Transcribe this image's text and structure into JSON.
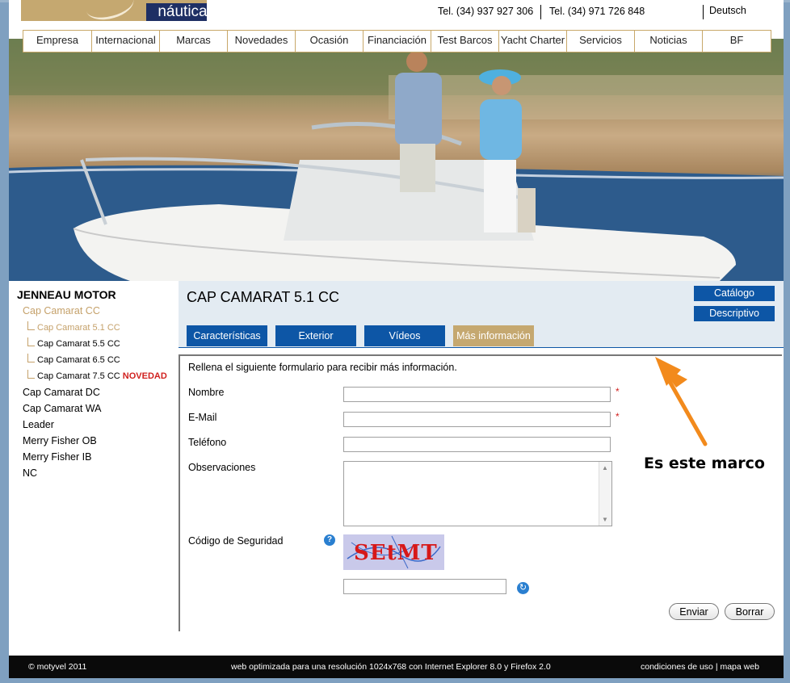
{
  "header": {
    "logo_text": "náutica",
    "phone1": "Tel. (34) 937 927 306",
    "phone2": "Tel. (34) 971 726 848",
    "language": "Deutsch"
  },
  "nav": {
    "items": [
      "Empresa",
      "Internacional",
      "Marcas",
      "Novedades",
      "Ocasión",
      "Financiación",
      "Test Barcos",
      "Yacht Charter",
      "Servicios",
      "Noticias",
      "BF"
    ]
  },
  "sidebar": {
    "title": "JENNEAU MOTOR",
    "group": "Cap Camarat CC",
    "subitems": [
      "Cap Camarat 5.1 CC",
      "Cap Camarat 5.5 CC",
      "Cap Camarat 6.5 CC",
      "Cap Camarat 7.5 CC"
    ],
    "new_badge": "NOVEDAD",
    "items": [
      "Cap Camarat DC",
      "Cap Camarat WA",
      "Leader",
      "Merry Fisher OB",
      "Merry Fisher IB",
      "NC"
    ]
  },
  "content": {
    "title": "CAP CAMARAT 5.1 CC",
    "buttons": [
      "Catálogo",
      "Descriptivo"
    ],
    "tabs": [
      "Características",
      "Exterior",
      "Vídeos",
      "Más información"
    ],
    "active_tab": "Más información"
  },
  "form": {
    "intro": "Rellena el siguiente formulario para recibir más información.",
    "fields": {
      "name_label": "Nombre",
      "email_label": "E-Mail",
      "phone_label": "Teléfono",
      "notes_label": "Observaciones",
      "captcha_label": "Código de Seguridad"
    },
    "required_mark": "*",
    "captcha_text": "SEtMT",
    "submit": "Enviar",
    "reset": "Borrar"
  },
  "annotation": "Es este marco",
  "footer": {
    "copyright": "© motyvel 2011",
    "note": "web optimizada para una resolución 1024x768 con Internet Explorer 8.0 y Firefox 2.0",
    "links": "condiciones de uso | mapa web"
  },
  "colors": {
    "brand_blue": "#0d56a6",
    "brand_gold": "#c5a870",
    "navy": "#1e2f64",
    "accent_orange": "#f28a1c",
    "required_red": "#d0201e"
  }
}
